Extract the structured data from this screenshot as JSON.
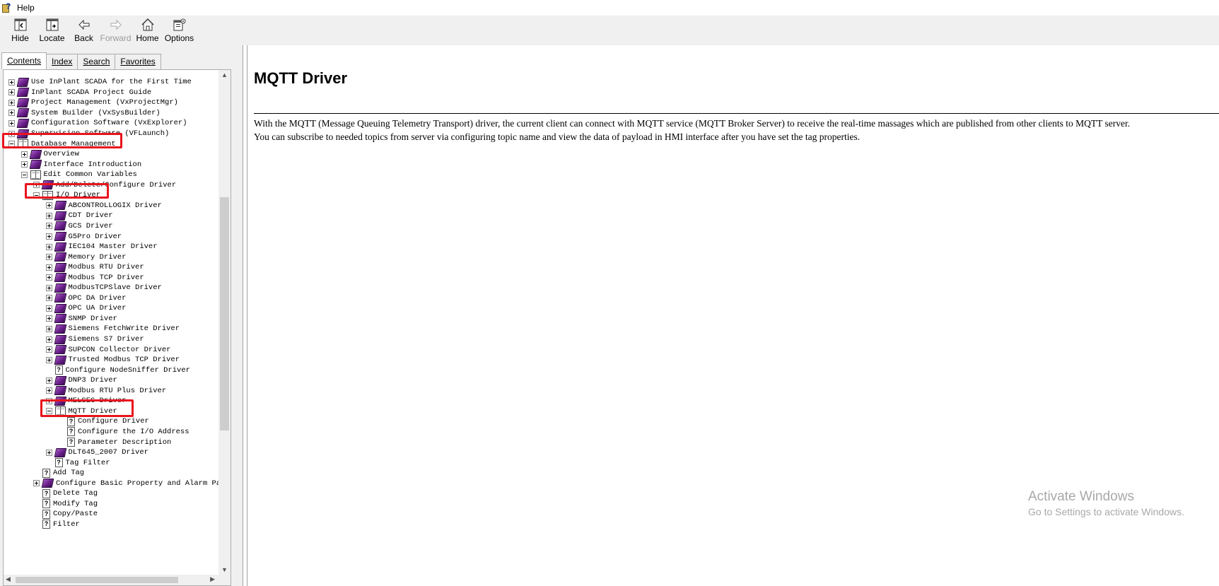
{
  "window": {
    "title": "Help"
  },
  "toolbar": {
    "hide": "Hide",
    "locate": "Locate",
    "back": "Back",
    "forward": "Forward",
    "home": "Home",
    "options": "Options"
  },
  "tabs": [
    "Contents",
    "Index",
    "Search",
    "Favorites"
  ],
  "tree": [
    {
      "label": "Use InPlant SCADA for the First Time",
      "level": 0,
      "exp": "plus",
      "icon": "closed"
    },
    {
      "label": "InPlant SCADA Project Guide",
      "level": 0,
      "exp": "plus",
      "icon": "closed"
    },
    {
      "label": "Project Management (VxProjectMgr)",
      "level": 0,
      "exp": "plus",
      "icon": "closed"
    },
    {
      "label": "System Builder (VxSysBuilder)",
      "level": 0,
      "exp": "plus",
      "icon": "closed"
    },
    {
      "label": "Configuration Software (VxExplorer)",
      "level": 0,
      "exp": "plus",
      "icon": "closed"
    },
    {
      "label": "Supervision Software (VFLaunch)",
      "level": 0,
      "exp": "plus",
      "icon": "closed"
    },
    {
      "label": "Database Management",
      "level": 0,
      "exp": "minus",
      "icon": "open"
    },
    {
      "label": "Overview",
      "level": 1,
      "exp": "plus",
      "icon": "closed"
    },
    {
      "label": "Interface Introduction",
      "level": 1,
      "exp": "plus",
      "icon": "closed"
    },
    {
      "label": "Edit Common Variables",
      "level": 1,
      "exp": "minus",
      "icon": "open"
    },
    {
      "label": "Add/Delete/Configure Driver",
      "level": 2,
      "exp": "plus",
      "icon": "closed"
    },
    {
      "label": "I/O Driver",
      "level": 2,
      "exp": "minus",
      "icon": "open"
    },
    {
      "label": "ABCONTROLLOGIX Driver",
      "level": 3,
      "exp": "plus",
      "icon": "closed"
    },
    {
      "label": "CDT Driver",
      "level": 3,
      "exp": "plus",
      "icon": "closed"
    },
    {
      "label": "GCS Driver",
      "level": 3,
      "exp": "plus",
      "icon": "closed"
    },
    {
      "label": "G5Pro Driver",
      "level": 3,
      "exp": "plus",
      "icon": "closed"
    },
    {
      "label": "IEC104 Master Driver",
      "level": 3,
      "exp": "plus",
      "icon": "closed"
    },
    {
      "label": "Memory Driver",
      "level": 3,
      "exp": "plus",
      "icon": "closed"
    },
    {
      "label": "Modbus RTU Driver",
      "level": 3,
      "exp": "plus",
      "icon": "closed"
    },
    {
      "label": "Modbus TCP Driver",
      "level": 3,
      "exp": "plus",
      "icon": "closed"
    },
    {
      "label": "ModbusTCPSlave Driver",
      "level": 3,
      "exp": "plus",
      "icon": "closed"
    },
    {
      "label": "OPC DA Driver",
      "level": 3,
      "exp": "plus",
      "icon": "closed"
    },
    {
      "label": "OPC UA Driver",
      "level": 3,
      "exp": "plus",
      "icon": "closed"
    },
    {
      "label": "SNMP Driver",
      "level": 3,
      "exp": "plus",
      "icon": "closed"
    },
    {
      "label": "Siemens FetchWrite Driver",
      "level": 3,
      "exp": "plus",
      "icon": "closed"
    },
    {
      "label": "Siemens S7 Driver",
      "level": 3,
      "exp": "plus",
      "icon": "closed"
    },
    {
      "label": "SUPCON Collector Driver",
      "level": 3,
      "exp": "plus",
      "icon": "closed"
    },
    {
      "label": "Trusted Modbus TCP Driver",
      "level": 3,
      "exp": "plus",
      "icon": "closed"
    },
    {
      "label": "Configure NodeSniffer Driver",
      "level": 3,
      "exp": "none",
      "icon": "page"
    },
    {
      "label": "DNP3 Driver",
      "level": 3,
      "exp": "plus",
      "icon": "closed"
    },
    {
      "label": "Modbus RTU Plus Driver",
      "level": 3,
      "exp": "plus",
      "icon": "closed"
    },
    {
      "label": "MELSEC Driver",
      "level": 3,
      "exp": "plus",
      "icon": "closed"
    },
    {
      "label": "MQTT Driver",
      "level": 3,
      "exp": "minus",
      "icon": "open"
    },
    {
      "label": "Configure Driver",
      "level": 4,
      "exp": "none",
      "icon": "page"
    },
    {
      "label": "Configure the I/O Address",
      "level": 4,
      "exp": "none",
      "icon": "page"
    },
    {
      "label": "Parameter Description",
      "level": 4,
      "exp": "none",
      "icon": "page"
    },
    {
      "label": "DLT645_2007 Driver",
      "level": 3,
      "exp": "plus",
      "icon": "closed"
    },
    {
      "label": "Tag Filter",
      "level": 3,
      "exp": "none",
      "icon": "page"
    },
    {
      "label": "Add Tag",
      "level": 2,
      "exp": "none",
      "icon": "page"
    },
    {
      "label": "Configure Basic Property and Alarm Parameters",
      "level": 2,
      "exp": "plus",
      "icon": "closed"
    },
    {
      "label": "Delete Tag",
      "level": 2,
      "exp": "none",
      "icon": "page"
    },
    {
      "label": "Modify Tag",
      "level": 2,
      "exp": "none",
      "icon": "page"
    },
    {
      "label": "Copy/Paste",
      "level": 2,
      "exp": "none",
      "icon": "page"
    },
    {
      "label": "Filter",
      "level": 2,
      "exp": "none",
      "icon": "page"
    }
  ],
  "content": {
    "title": "MQTT Driver",
    "paragraph_1": "With the MQTT (Message Queuing Telemetry Transport) driver, the current client can connect with MQTT service (MQTT Broker Server) to receive the real-time massages which are published from other clients to MQTT server.",
    "paragraph_2": "You can subscribe to needed topics from server via configuring topic name and view the data of payload in HMI interface after you have set the tag properties."
  },
  "watermark": {
    "line1": "Activate Windows",
    "line2": "Go to Settings to activate Windows."
  }
}
